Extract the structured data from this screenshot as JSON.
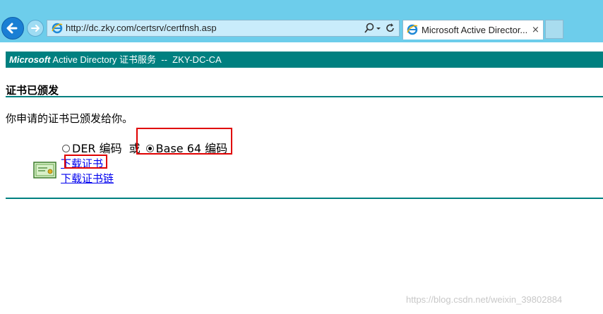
{
  "browser": {
    "address_url": "http://dc.zky.com/certsrv/certfnsh.asp",
    "tab_title": "Microsoft Active Director...",
    "tab_close": "×",
    "back_icon": "back-arrow-icon",
    "forward_icon": "forward-arrow-icon"
  },
  "page": {
    "header_brand": "Microsoft",
    "header_rest": " Active Directory 证书服务  --  ZKY-DC-CA",
    "title": "证书已颁发",
    "intro": "你申请的证书已颁发给你。",
    "encoding_options": [
      {
        "label": "DER 编码",
        "selected": false
      },
      {
        "label": "Base 64 编码",
        "selected": true
      }
    ],
    "or_word": "或",
    "download_cert": "下载证书",
    "download_chain": "下载证书链"
  },
  "watermark": "https://blog.csdn.net/weixin_39802884",
  "colors": {
    "teal": "#008080",
    "chrome": "#6dcdeb",
    "link": "#0000ee",
    "highlight": "#e00000"
  }
}
